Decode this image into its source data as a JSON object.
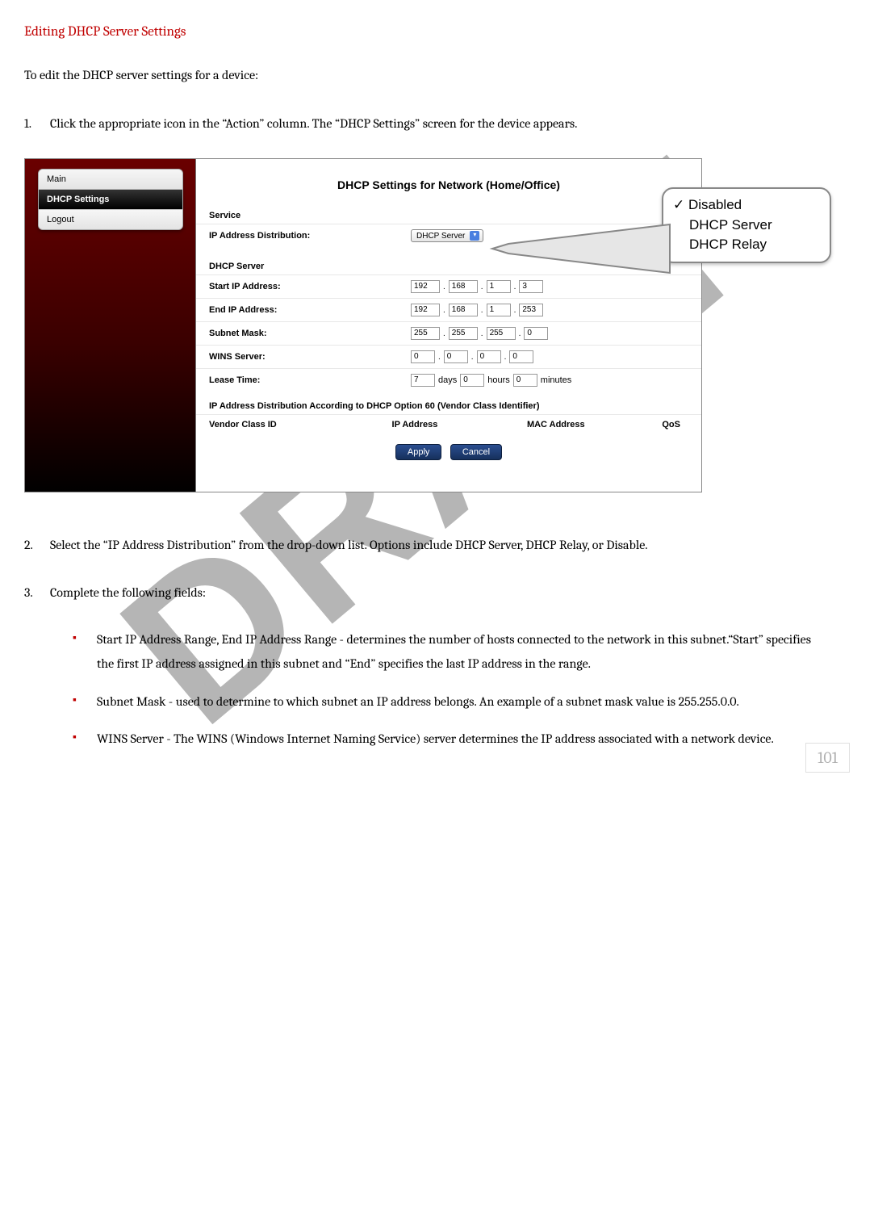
{
  "watermark": "DRAFT",
  "heading": "Editing DHCP Server Settings",
  "intro": "To edit the DHCP server settings for a device:",
  "steps": [
    {
      "num": "1.",
      "text": "Click the appropriate icon in the “Action” column. The “DHCP Settings” screen for the device appears."
    },
    {
      "num": "2.",
      "text": "Select the “IP Address Distribution” from the drop-down list. Options include DHCP Server, DHCP Relay, or Disable."
    },
    {
      "num": "3.",
      "text": "Complete the following fields:"
    }
  ],
  "bullets": [
    "Start IP Address Range, End IP Address Range - determines the number of hosts connected to the network in this subnet.“Start” specifies the first IP address assigned in this subnet and “End” specifies the last IP address in the range.",
    "Subnet Mask - used to determine to which subnet an IP address belongs. An example of a subnet mask value is 255.255.0.0.",
    "WINS Server - The WINS (Windows Internet Naming Service) server determines the IP address associated with a network device."
  ],
  "screenshot": {
    "title": "DHCP Settings for Network (Home/Office)",
    "sidebar": {
      "items": [
        "Main",
        "DHCP Settings",
        "Logout"
      ],
      "active_index": 1
    },
    "service_head": "Service",
    "ipdist_label": "IP Address Distribution:",
    "ipdist_value": "DHCP Server",
    "dhcp_head": "DHCP Server",
    "rows": {
      "start_ip_label": "Start IP Address:",
      "start_ip": [
        "192",
        "168",
        "1",
        "3"
      ],
      "end_ip_label": "End IP Address:",
      "end_ip": [
        "192",
        "168",
        "1",
        "253"
      ],
      "subnet_label": "Subnet Mask:",
      "subnet": [
        "255",
        "255",
        "255",
        "0"
      ],
      "wins_label": "WINS Server:",
      "wins": [
        "0",
        "0",
        "0",
        "0"
      ],
      "lease_label": "Lease Time:",
      "lease_days": "7",
      "lease_days_u": "days",
      "lease_hours": "0",
      "lease_hours_u": "hours",
      "lease_mins": "0",
      "lease_mins_u": "minutes"
    },
    "note": "IP Address Distribution According to DHCP Option 60 (Vendor Class Identifier)",
    "columns": {
      "c1": "Vendor Class ID",
      "c2": "IP Address",
      "c3": "MAC Address",
      "c4": "QoS"
    },
    "buttons": {
      "apply": "Apply",
      "cancel": "Cancel"
    },
    "dropdown_options": [
      "Disabled",
      "DHCP Server",
      "DHCP Relay"
    ]
  },
  "page_number": "101"
}
